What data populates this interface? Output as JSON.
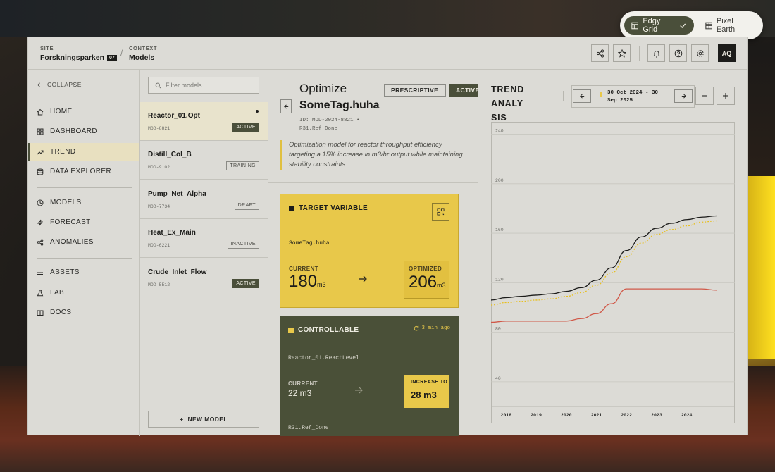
{
  "theme_switch": {
    "options": [
      "Edgy Grid",
      "Pixel Earth"
    ],
    "active": "Edgy Grid"
  },
  "topbar": {
    "site_label": "SITE",
    "site_value": "Forskningsparken",
    "site_tag": "07",
    "context_label": "CONTEXT",
    "context_value": "Models",
    "avatar": "AQ"
  },
  "sidebar": {
    "collapse": "COLLAPSE",
    "items": [
      "HOME",
      "DASHBOARD",
      "TREND",
      "DATA EXPLORER",
      "MODELS",
      "FORECAST",
      "ANOMALIES",
      "ASSETS",
      "LAB",
      "DOCS"
    ],
    "active": "TREND"
  },
  "models": {
    "filter_placeholder": "Filter models...",
    "list": [
      {
        "name": "Reactor_01.Opt",
        "id": "MOD-8821",
        "status": "ACTIVE"
      },
      {
        "name": "Distill_Col_B",
        "id": "MOD-9102",
        "status": "TRAINING"
      },
      {
        "name": "Pump_Net_Alpha",
        "id": "MOD-7734",
        "status": "DRAFT"
      },
      {
        "name": "Heat_Ex_Main",
        "id": "MOD-6221",
        "status": "INACTIVE"
      },
      {
        "name": "Crude_Inlet_Flow",
        "id": "MOD-5512",
        "status": "ACTIVE"
      }
    ],
    "new_model": "NEW MODEL"
  },
  "detail": {
    "kicker": "Optimize",
    "title": "SomeTag.huha",
    "meta_line1": "ID: MOD-2024-8821 •",
    "meta_line2": "R31.Ref_Done",
    "pill_type": "PRESCRIPTIVE",
    "pill_status": "ACTIVE",
    "description": "Optimization model for reactor throughput efficiency targeting a 15% increase in m3/hr output while maintaining stability constraints.",
    "target": {
      "heading": "TARGET VARIABLE",
      "tag": "SomeTag.huha",
      "current_label": "CURRENT",
      "current_value": "180",
      "current_unit": "m3",
      "optimized_label": "OPTIMIZED",
      "optimized_value": "206",
      "optimized_unit": "m3"
    },
    "controllable": {
      "heading": "CONTROLLABLE",
      "sync": "3 min ago",
      "tag": "Reactor_01.ReactLevel",
      "current_label": "CURRENT",
      "current_value": "22 m3",
      "increase_label": "INCREASE TO",
      "increase_value": "28 m3",
      "footer_tag": "R31.Ref_Done"
    }
  },
  "trend": {
    "title_lines": [
      "TREND",
      "ANALY",
      "SIS"
    ],
    "date_line1": "30 Oct 2024 - 30",
    "date_line2": "Sep 2025"
  },
  "chart_data": {
    "type": "line",
    "x": [
      2017.5,
      2018,
      2018.5,
      2019,
      2019.5,
      2020,
      2020.5,
      2021,
      2021.5,
      2022,
      2022.5,
      2023,
      2023.5,
      2024,
      2024.5,
      2025
    ],
    "xticks": [
      "2018",
      "2019",
      "2020",
      "2021",
      "2022",
      "2023",
      "2024"
    ],
    "yticks": [
      "40",
      "80",
      "120",
      "160",
      "200",
      "240"
    ],
    "ylim": [
      20,
      250
    ],
    "xlim": [
      2017.5,
      2025.6
    ],
    "series": [
      {
        "color": "#1c1c1a",
        "dash": false,
        "values": [
          106,
          108,
          109,
          110,
          111,
          113,
          116,
          122,
          132,
          146,
          157,
          164,
          168,
          171,
          173,
          174
        ]
      },
      {
        "color": "#e8c020",
        "dash": true,
        "values": [
          102,
          104,
          105,
          106,
          107,
          109,
          112,
          118,
          128,
          141,
          152,
          159,
          163,
          166,
          169,
          170
        ]
      },
      {
        "color": "#d05848",
        "dash": false,
        "values": [
          88,
          89,
          89,
          89,
          89,
          89,
          91,
          95,
          103,
          115,
          115,
          115,
          115,
          115,
          115,
          114
        ]
      }
    ]
  },
  "colors": {
    "accent_yellow": "#e8c84a",
    "dark_olive": "#4a5038",
    "panel": "#dcdbd6"
  }
}
